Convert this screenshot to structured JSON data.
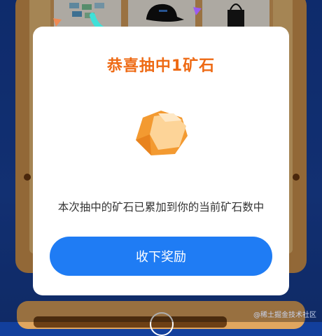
{
  "modal": {
    "title": "恭喜抽中1矿石",
    "message": "本次抽中的矿石已累加到你的当前矿石数中",
    "accept_label": "收下奖励",
    "reward_icon": "ore-icon"
  },
  "background": {
    "prize_items": [
      "stickers-prize-icon",
      "cap-prize-icon",
      "tote-bag-prize-icon"
    ]
  },
  "watermark": "@稀土掘金技术社区",
  "colors": {
    "title": "#ee6a14",
    "button": "#1f7cf4",
    "board": "#d79a52",
    "page_bg": "#16409f"
  }
}
